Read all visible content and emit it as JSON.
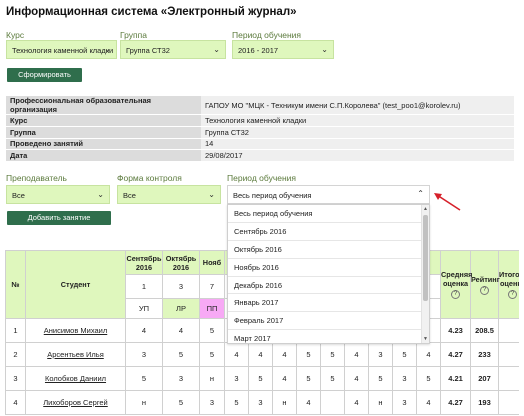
{
  "page_title": "Информационная система «Электронный журнал»",
  "filters": {
    "course_label": "Курс",
    "course_value": "Технология каменной кладки",
    "group_label": "Группа",
    "group_value": "Группа СТ32",
    "period_label": "Период обучения",
    "period_value": "2016 - 2017",
    "submit_label": "Сформировать"
  },
  "info": [
    {
      "key": "Профессиональная образовательная организация",
      "value": "ГАПОУ МО \"МЦК - Техникум имени С.П.Королева\" (test_poo1@korolev.ru)"
    },
    {
      "key": "Курс",
      "value": "Технология каменной кладки"
    },
    {
      "key": "Группа",
      "value": "Группа СТ32"
    },
    {
      "key": "Проведено занятий",
      "value": "14"
    },
    {
      "key": "Дата",
      "value": "29/08/2017"
    }
  ],
  "subfilters": {
    "teacher_label": "Преподаватель",
    "teacher_value": "Все",
    "control_label": "Форма контроля",
    "control_value": "Все",
    "period_label": "Период обучения",
    "period_value": "Весь период обучения",
    "add_lesson_label": "Добавить занятие"
  },
  "period_options": [
    "Весь период обучения",
    "Сентябрь 2016",
    "Октябрь 2016",
    "Ноябрь 2016",
    "Декабрь 2016",
    "Январь 2017",
    "Февраль 2017",
    "Март 2017"
  ],
  "journal": {
    "headers": {
      "num": "№",
      "student": "Студент",
      "months": [
        "Сентябрь 2016",
        "Октябрь 2016",
        "Нояб"
      ],
      "avg": "Средняя оценка",
      "rating": "Рейтинг",
      "final": "Итоговая оценка"
    },
    "lesson_counts": [
      "1",
      "3",
      "7"
    ],
    "control_forms": [
      "УП",
      "ЛР",
      "ПП"
    ],
    "rows": [
      {
        "n": "1",
        "name": "Анисимов Михаил",
        "m1": "4",
        "m2": "4",
        "m3": "5",
        "rest": [
          "",
          "",
          "",
          "",
          "",
          "",
          "",
          "",
          ""
        ],
        "avg": "4.23",
        "rating": "208.5"
      },
      {
        "n": "2",
        "name": "Арсентьев Илья",
        "m1": "3",
        "m2": "5",
        "m3": "5",
        "rest": [
          "4",
          "4",
          "4",
          "5",
          "5",
          "4",
          "3",
          "5",
          "4"
        ],
        "avg": "4.27",
        "rating": "233"
      },
      {
        "n": "3",
        "name": "Колобков Даниил",
        "m1": "5",
        "m2": "3",
        "m3": "н",
        "rest": [
          "3",
          "5",
          "4",
          "5",
          "5",
          "4",
          "5",
          "3",
          "5"
        ],
        "avg": "4.21",
        "rating": "207"
      },
      {
        "n": "4",
        "name": "Лихоборов Сергей",
        "m1": "н",
        "m2": "5",
        "m3": "3",
        "rest": [
          "5",
          "3",
          "н",
          "4",
          "",
          "4",
          "н",
          "3",
          "4"
        ],
        "avg": "4.27",
        "rating": "193"
      }
    ]
  },
  "colors": {
    "accent_green": "#2f6e4c",
    "select_bg": "#dff7bd",
    "form_lr": "#dff7bd",
    "form_pp": "#f7a9f5",
    "arrow": "#d6202a"
  }
}
